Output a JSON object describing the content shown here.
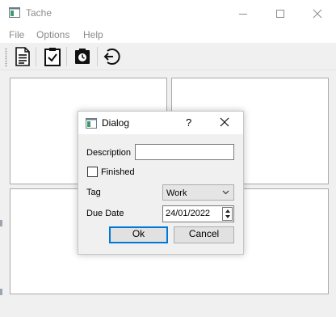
{
  "window": {
    "title": "Tache",
    "controls": {
      "minimize_icon": "minimize-icon",
      "maximize_icon": "maximize-icon",
      "close_icon": "close-icon"
    }
  },
  "menubar": {
    "items": [
      "File",
      "Options",
      "Help"
    ]
  },
  "toolbar": {
    "tools": [
      {
        "icon": "document-list-icon"
      },
      {
        "icon": "clipboard-check-icon"
      },
      {
        "icon": "timer-icon"
      },
      {
        "icon": "back-arrow-icon"
      }
    ]
  },
  "dialog": {
    "title": "Dialog",
    "help_label": "?",
    "description_label": "Description",
    "description_value": "",
    "finished_label": "Finished",
    "finished_checked": false,
    "tag_label": "Tag",
    "tag_value": "Work",
    "due_date_label": "Due Date",
    "due_date_value": "24/01/2022",
    "ok_label": "Ok",
    "cancel_label": "Cancel"
  },
  "colors": {
    "accent": "#0078d7",
    "window_bg": "#f0f0f0",
    "pane_bg": "#ffffff",
    "border": "#a9a9a9"
  }
}
